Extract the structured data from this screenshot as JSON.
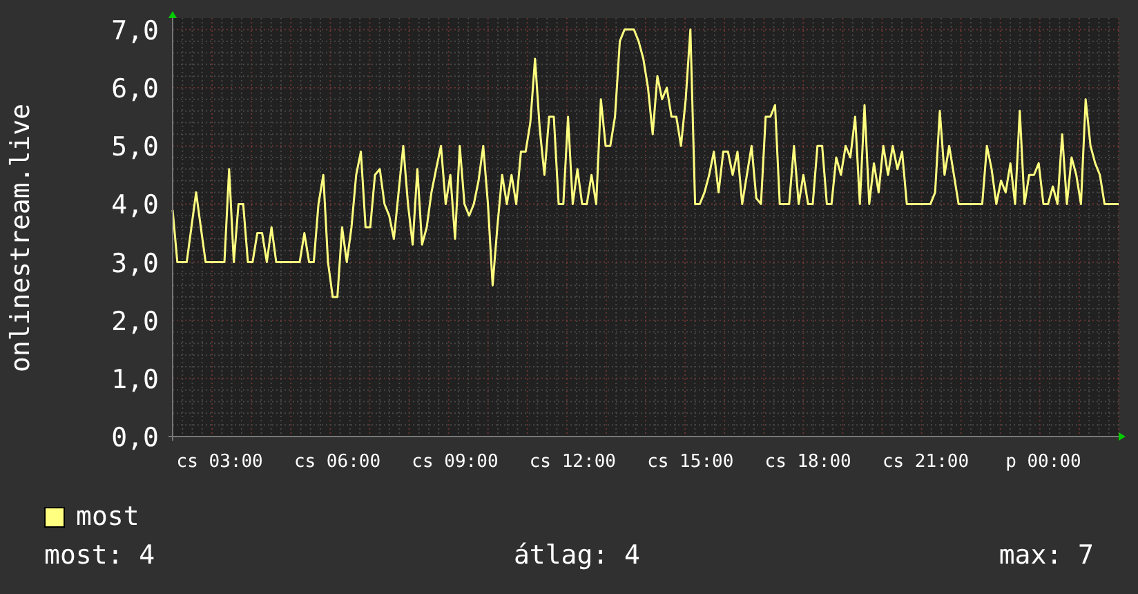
{
  "chart": {
    "chart_data": {
      "type": "line",
      "ylabel": "onlinestream.live",
      "grid": true,
      "ylim": [
        0,
        7.2
      ],
      "categories": [
        null,
        null,
        null,
        null,
        null,
        null,
        null,
        null,
        null,
        null,
        "cs 03:00",
        null,
        null,
        null,
        null,
        null,
        null,
        null,
        null,
        null,
        null,
        null,
        null,
        null,
        null,
        null,
        null,
        null,
        null,
        null,
        null,
        null,
        null,
        null,
        null,
        "cs 06:00",
        null,
        null,
        null,
        null,
        null,
        null,
        null,
        null,
        null,
        null,
        null,
        null,
        null,
        null,
        null,
        null,
        null,
        null,
        null,
        null,
        null,
        null,
        null,
        null,
        "cs 09:00",
        null,
        null,
        null,
        null,
        null,
        null,
        null,
        null,
        null,
        null,
        null,
        null,
        null,
        null,
        null,
        null,
        null,
        null,
        null,
        null,
        null,
        null,
        null,
        null,
        "cs 12:00",
        null,
        null,
        null,
        null,
        null,
        null,
        null,
        null,
        null,
        null,
        null,
        null,
        null,
        null,
        null,
        null,
        null,
        null,
        null,
        null,
        null,
        null,
        null,
        null,
        "cs 15:00",
        null,
        null,
        null,
        null,
        null,
        null,
        null,
        null,
        null,
        null,
        null,
        null,
        null,
        null,
        null,
        null,
        null,
        null,
        null,
        null,
        null,
        null,
        null,
        null,
        "cs 18:00",
        null,
        null,
        null,
        null,
        null,
        null,
        null,
        null,
        null,
        null,
        null,
        null,
        null,
        null,
        null,
        null,
        null,
        null,
        null,
        null,
        null,
        null,
        null,
        null,
        "cs 21:00",
        null,
        null,
        null,
        null,
        null,
        null,
        null,
        null,
        null,
        null,
        null,
        null,
        null,
        null,
        null,
        null,
        null,
        null,
        null,
        null,
        null,
        null,
        null,
        null,
        "p 00:00",
        null,
        null,
        null,
        null,
        null,
        null,
        null,
        null,
        null,
        null,
        null,
        null,
        null,
        null,
        null,
        null
      ],
      "yticks": [
        {
          "value": 0,
          "label": "0,0"
        },
        {
          "value": 1,
          "label": "1,0"
        },
        {
          "value": 2,
          "label": "2,0"
        },
        {
          "value": 3,
          "label": "3,0"
        },
        {
          "value": 4,
          "label": "4,0"
        },
        {
          "value": 5,
          "label": "5,0"
        },
        {
          "value": 6,
          "label": "6,0"
        },
        {
          "value": 7,
          "label": "7,0"
        }
      ],
      "series": [
        {
          "name": "most",
          "color": "#ffff80",
          "values": [
            3.9,
            3,
            3,
            3,
            3.6,
            4.2,
            3.6,
            3,
            3,
            3,
            3,
            3,
            4.6,
            3,
            4,
            4,
            3,
            3,
            3.5,
            3.5,
            3,
            3.6,
            3,
            3,
            3,
            3,
            3,
            3,
            3.5,
            3,
            3,
            4,
            4.5,
            3,
            2.4,
            2.4,
            3.6,
            3,
            3.6,
            4.5,
            4.9,
            3.6,
            3.6,
            4.5,
            4.6,
            4,
            3.8,
            3.4,
            4.2,
            5,
            4,
            3.3,
            4.6,
            3.3,
            3.6,
            4.2,
            4.6,
            5,
            4,
            4.5,
            3.4,
            5,
            4,
            3.8,
            4,
            4.4,
            5,
            4,
            2.6,
            3.6,
            4.5,
            4,
            4.5,
            4,
            4.9,
            4.9,
            5.4,
            6.5,
            5.3,
            4.5,
            5.5,
            5.5,
            4,
            4,
            5.5,
            4,
            4.6,
            4,
            4,
            4.5,
            4,
            5.8,
            5,
            5,
            5.5,
            6.8,
            7,
            7,
            7,
            6.8,
            6.5,
            6,
            5.2,
            6.2,
            5.8,
            6,
            5.5,
            5.5,
            5,
            5.8,
            7,
            4,
            4,
            4.2,
            4.5,
            4.9,
            4.2,
            4.9,
            4.9,
            4.5,
            4.9,
            4,
            4.5,
            5,
            4.1,
            4,
            5.5,
            5.5,
            5.7,
            4,
            4,
            4,
            5,
            4,
            4.5,
            4,
            4,
            5,
            5,
            4,
            4,
            4.8,
            4.5,
            5,
            4.8,
            5.5,
            4,
            5.7,
            4,
            4.7,
            4.2,
            5,
            4.5,
            5,
            4.6,
            4.9,
            4,
            4,
            4,
            4,
            4,
            4,
            4.2,
            5.6,
            4.5,
            5,
            4.5,
            4,
            4,
            4,
            4,
            4,
            4,
            5,
            4.6,
            4,
            4.4,
            4.2,
            4.7,
            4,
            5.6,
            4,
            4.5,
            4.5,
            4.7,
            4,
            4,
            4.3,
            4,
            5.2,
            4,
            4.8,
            4.5,
            4,
            5.8,
            5,
            4.7,
            4.5,
            4,
            4,
            4,
            4
          ]
        }
      ]
    }
  },
  "stats": [
    {
      "label": "most: 4"
    },
    {
      "label": "átlag: 4"
    },
    {
      "label": "max: 7"
    }
  ]
}
